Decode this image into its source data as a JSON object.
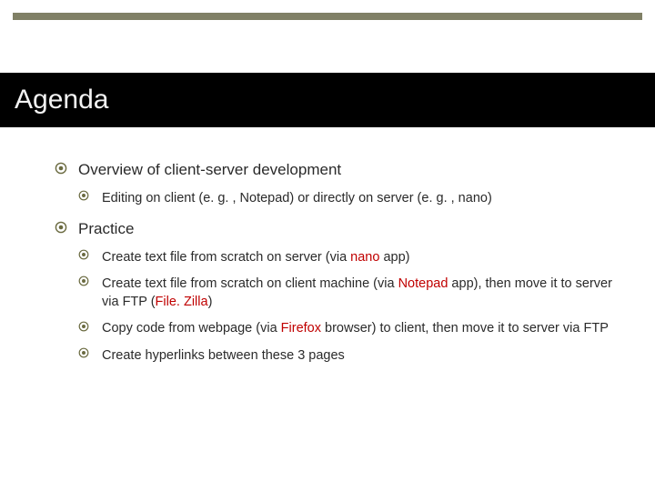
{
  "colors": {
    "accent_bar": "#808066",
    "title_bg": "#000000",
    "title_fg": "#f3f3f3",
    "bullet_fill": "#6a6a40",
    "bullet_stroke": "#6a6a40",
    "highlight": "#c00000"
  },
  "slide": {
    "title": "Agenda",
    "items": [
      {
        "text_before": "Overview of client-server development",
        "highlight": "",
        "text_after": "",
        "children": [
          {
            "text_before": "Editing on client (e. g. , Notepad) or directly on server (e. g. , nano)",
            "highlight": "",
            "text_after": ""
          }
        ]
      },
      {
        "text_before": "Practice",
        "highlight": "",
        "text_after": "",
        "children": [
          {
            "text_before": "Create text file from scratch on server (via ",
            "highlight": "nano",
            "text_after": " app)"
          },
          {
            "text_before": "Create text file from scratch on client machine (via ",
            "highlight": "Notepad",
            "text_after": " app), then move it to server via FTP (",
            "highlight2": "File. Zilla",
            "text_after2": ")"
          },
          {
            "text_before": "Copy code from webpage (via ",
            "highlight": "Firefox",
            "text_after": " browser) to client, then move it to server via FTP"
          },
          {
            "text_before": "Create hyperlinks between these 3 pages",
            "highlight": "",
            "text_after": ""
          }
        ]
      }
    ]
  }
}
